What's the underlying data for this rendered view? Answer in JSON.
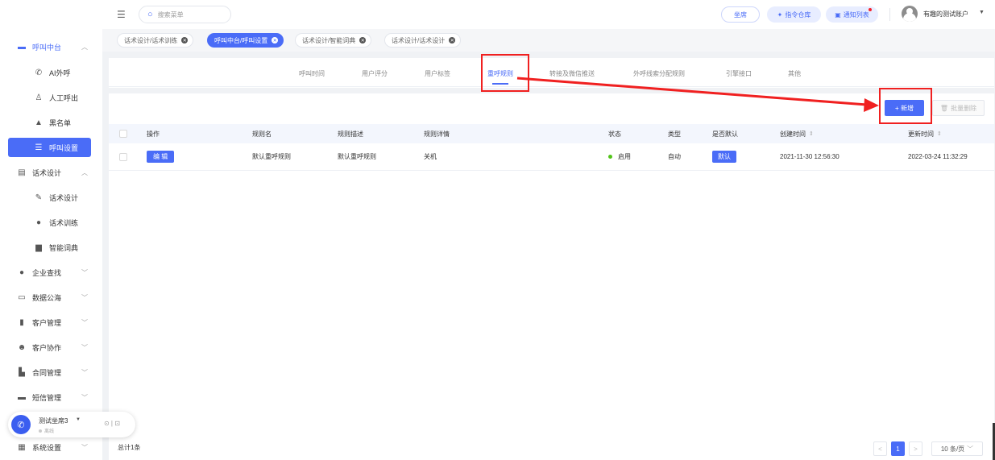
{
  "sidebar": {
    "items": [
      {
        "label": "呼叫中台",
        "icon": "monitor-icon",
        "chev": "^"
      },
      {
        "label": "AI外呼",
        "icon": "phone-icon"
      },
      {
        "label": "人工呼出",
        "icon": "agent-icon"
      },
      {
        "label": "黑名单",
        "icon": "warning-icon"
      },
      {
        "label": "呼叫设置",
        "icon": "sliders-icon"
      },
      {
        "label": "话术设计",
        "icon": "doc-icon",
        "chev": "^"
      },
      {
        "label": "话术设计",
        "icon": "pen-icon"
      },
      {
        "label": "话术训练",
        "icon": "bot-icon"
      },
      {
        "label": "智能词典",
        "icon": "book-icon"
      },
      {
        "label": "企业查找",
        "icon": "bulb-icon",
        "chev": "v"
      },
      {
        "label": "数据公海",
        "icon": "chart-icon",
        "chev": "v"
      },
      {
        "label": "客户管理",
        "icon": "customer-icon",
        "chev": "v"
      },
      {
        "label": "客户协作",
        "icon": "face-icon",
        "chev": "v"
      },
      {
        "label": "合同管理",
        "icon": "contract-icon",
        "chev": "v"
      },
      {
        "label": "短信管理",
        "icon": "sms-icon",
        "chev": "v"
      },
      {
        "label": "系统设置",
        "icon": "grid-icon",
        "chev": "v"
      }
    ]
  },
  "topbar": {
    "search_placeholder": "搜索菜单",
    "seat_label": "坐席",
    "cmd_label": "指令仓库",
    "notice_label": "通知列表",
    "account": "有趣的测试账户"
  },
  "tags": [
    {
      "label": "话术设计/话术训练"
    },
    {
      "label": "呼叫中台/呼叫设置"
    },
    {
      "label": "话术设计/智能词典"
    },
    {
      "label": "话术设计/话术设计"
    }
  ],
  "tabs": [
    "呼叫时间",
    "用户评分",
    "用户标签",
    "重呼规则",
    "转接及微信推送",
    "外呼线索分配规则",
    "引擎接口",
    "其他"
  ],
  "toolbar": {
    "new_label": "+ 新增",
    "batch_delete_label": "批量删除"
  },
  "table": {
    "headers": {
      "op": "操作",
      "name": "规则名",
      "desc": "规则描述",
      "detail": "规则详情",
      "status": "状态",
      "type": "类型",
      "default": "是否默认",
      "created": "创建时间",
      "updated": "更新时间"
    },
    "row": {
      "edit": "编 辑",
      "name": "默认重呼规则",
      "desc": "默认重呼规则",
      "detail": "关机",
      "status": "启用",
      "type": "自动",
      "default": "默认",
      "created": "2021-11-30 12:56:30",
      "updated": "2022-03-24 11:32:29"
    }
  },
  "footer": {
    "total": "总计1条",
    "page": "1",
    "page_size": "10 条/页"
  },
  "phone": {
    "name": "测试坐席3",
    "status": "离线"
  },
  "colors": {
    "accent": "#4a6cf7",
    "annotation": "#f02020",
    "status_green": "#52c41a"
  }
}
